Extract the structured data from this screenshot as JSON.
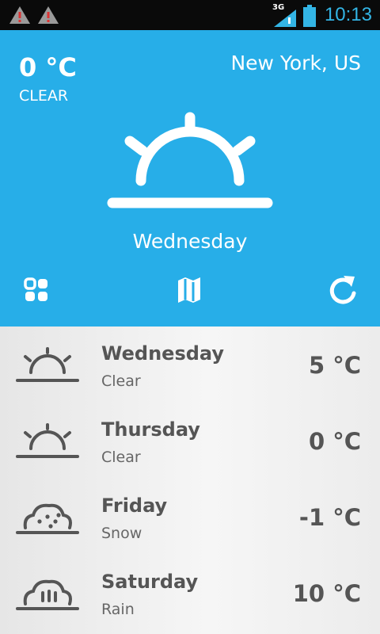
{
  "status_bar": {
    "time": "10:13",
    "network": "3G"
  },
  "current": {
    "temperature": "0 °C",
    "condition": "CLEAR",
    "location": "New York, US",
    "day": "Wednesday",
    "icon": "sunrise-icon"
  },
  "actions": [
    {
      "name": "grid-icon"
    },
    {
      "name": "map-icon"
    },
    {
      "name": "refresh-icon"
    }
  ],
  "forecast": [
    {
      "day": "Wednesday",
      "condition": "Clear",
      "temperature": "5 °C",
      "icon": "sunrise-icon"
    },
    {
      "day": "Thursday",
      "condition": "Clear",
      "temperature": "0 °C",
      "icon": "sunrise-icon"
    },
    {
      "day": "Friday",
      "condition": "Snow",
      "temperature": "-1 °C",
      "icon": "snow-icon"
    },
    {
      "day": "Saturday",
      "condition": "Rain",
      "temperature": "10 °C",
      "icon": "rain-icon"
    }
  ],
  "colors": {
    "accent": "#27aee8",
    "status_icon": "#33b5e5",
    "list_text": "#555555"
  }
}
